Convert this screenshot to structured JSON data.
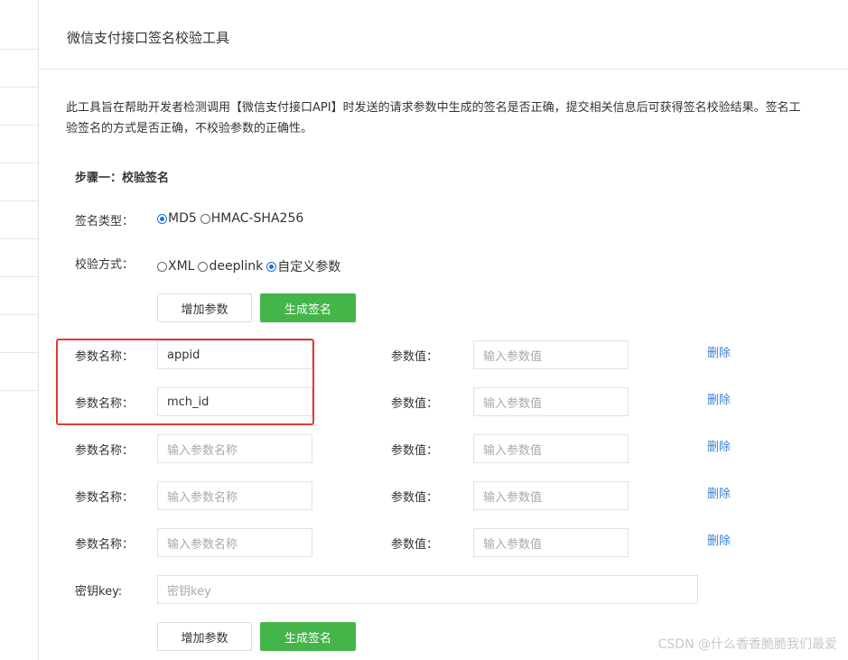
{
  "page": {
    "title": "微信支付接口签名校验工具",
    "description_line1": "此工具旨在帮助开发者检测调用【微信支付接口API】时发送的请求参数中生成的签名是否正确，提交相关信息后可获得签名校验结果。签名工",
    "description_line2": "验签名的方式是否正确，不校验参数的正确性。"
  },
  "step": {
    "title": "步骤一：校验签名"
  },
  "sign_type": {
    "label": "签名类型：",
    "options": [
      {
        "label": "MD5",
        "checked": true
      },
      {
        "label": "HMAC-SHA256",
        "checked": false
      }
    ]
  },
  "verify_mode": {
    "label": "校验方式：",
    "options": [
      {
        "label": "XML",
        "checked": false
      },
      {
        "label": "deeplink",
        "checked": false
      },
      {
        "label": "自定义参数",
        "checked": true
      }
    ]
  },
  "buttons": {
    "add_param": "增加参数",
    "generate_sign": "生成签名"
  },
  "params": {
    "name_label": "参数名称：",
    "value_label": "参数值：",
    "name_placeholder": "输入参数名称",
    "value_placeholder": "输入参数值",
    "delete_label": "删除",
    "rows": [
      {
        "name": "appid",
        "value": ""
      },
      {
        "name": "mch_id",
        "value": ""
      },
      {
        "name": "",
        "value": ""
      },
      {
        "name": "",
        "value": ""
      },
      {
        "name": "",
        "value": ""
      }
    ]
  },
  "key": {
    "label": "密钥key:",
    "placeholder": "密钥key",
    "value": ""
  },
  "watermark": "CSDN @什么香香脆脆我们最爱",
  "colors": {
    "primary_green": "#44b549",
    "link_blue": "#3b82d8",
    "highlight_red": "#e53935",
    "radio_blue": "#1e6fd9"
  }
}
